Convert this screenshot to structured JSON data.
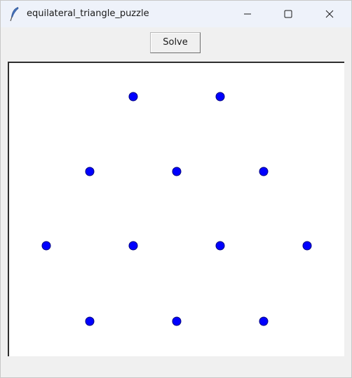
{
  "window": {
    "title": "equilateral_triangle_puzzle",
    "icon": "feather-icon",
    "controls": [
      "minimize-icon",
      "maximize-icon",
      "close-icon"
    ]
  },
  "toolbar": {
    "solve_label": "Solve"
  },
  "canvas": {
    "background": "#ffffff",
    "point_color": "#0000ff",
    "point_outline": "#000080",
    "point_count": 12,
    "rows": [
      {
        "columns": [
          3,
          5
        ]
      },
      {
        "columns": [
          2,
          4,
          6
        ]
      },
      {
        "columns": [
          1,
          3,
          5,
          7
        ]
      },
      {
        "columns": [
          2,
          4,
          6
        ]
      }
    ]
  }
}
